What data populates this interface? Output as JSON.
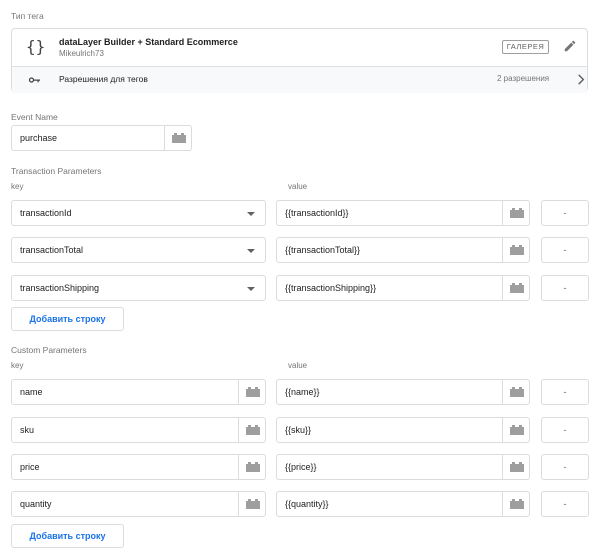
{
  "tag_type": {
    "section_label": "Тип тега",
    "title": "dataLayer Builder + Standard Ecommerce",
    "author": "Mikeulrich73",
    "gallery_label": "ГАЛЕРЕЯ",
    "permissions_label": "Разрешения для тегов",
    "permissions_count": "2 разрешения"
  },
  "event": {
    "label": "Event Name",
    "value": "purchase"
  },
  "transaction": {
    "label": "Transaction Parameters",
    "key_label": "key",
    "value_label": "value",
    "rows": [
      {
        "key": "transactionId",
        "value": "{{transactionId}}",
        "remove": "-"
      },
      {
        "key": "transactionTotal",
        "value": "{{transactionTotal}}",
        "remove": "-"
      },
      {
        "key": "transactionShipping",
        "value": "{{transactionShipping}}",
        "remove": "-"
      }
    ],
    "add_label": "Добавить строку"
  },
  "custom": {
    "label": "Custom Parameters",
    "key_label": "key",
    "value_label": "value",
    "rows": [
      {
        "key": "name",
        "value": "{{name}}",
        "remove": "-"
      },
      {
        "key": "sku",
        "value": "{{sku}}",
        "remove": "-"
      },
      {
        "key": "price",
        "value": "{{price}}",
        "remove": "-"
      },
      {
        "key": "quantity",
        "value": "{{quantity}}",
        "remove": "-"
      }
    ],
    "add_label": "Добавить строку"
  },
  "colors": {
    "accent": "#1a73e8",
    "border": "#dadce0",
    "muted": "#757575"
  },
  "icons": [
    "braces-icon",
    "pencil-icon",
    "key-icon",
    "chevron-right-icon",
    "variable-icon",
    "dropdown-arrow-icon"
  ]
}
